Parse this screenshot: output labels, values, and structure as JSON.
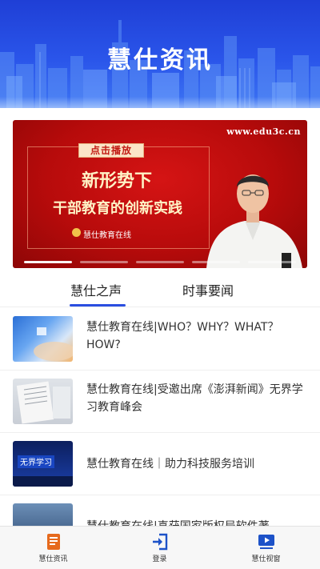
{
  "header": {
    "title": "慧仕资讯"
  },
  "banner": {
    "url": "www.edu3c.cn",
    "play_label": "点击播放",
    "headline_line1": "新形势下",
    "headline_line2": "干部教育的创新实践",
    "brand": "慧仕教育在线",
    "slides_total": 5,
    "slide_active": 1
  },
  "tabs": [
    {
      "label": "慧仕之声",
      "active": true
    },
    {
      "label": "时事要闻",
      "active": false
    }
  ],
  "articles": [
    {
      "title": "慧仕教育在线|WHO？WHY？WHAT？HOW?"
    },
    {
      "title": "慧仕教育在线|受邀出席《澎湃新闻》无界学习教育峰会"
    },
    {
      "title": "慧仕教育在线｜助力科技服务培训",
      "thumb_text": "无界学习"
    },
    {
      "title": "慧仕教育在线|喜获国家版权局软件著"
    }
  ],
  "bottom_nav": [
    {
      "label": "慧仕资讯",
      "icon": "news-icon",
      "color": "#e66a1d"
    },
    {
      "label": "登录",
      "icon": "login-icon",
      "color": "#1d52c8"
    },
    {
      "label": "慧仕视窗",
      "icon": "video-window-icon",
      "color": "#1d52c8"
    }
  ],
  "colors": {
    "header_blue": "#2a55ea",
    "banner_red": "#c10f0f",
    "tab_accent": "#2a4ee0"
  }
}
